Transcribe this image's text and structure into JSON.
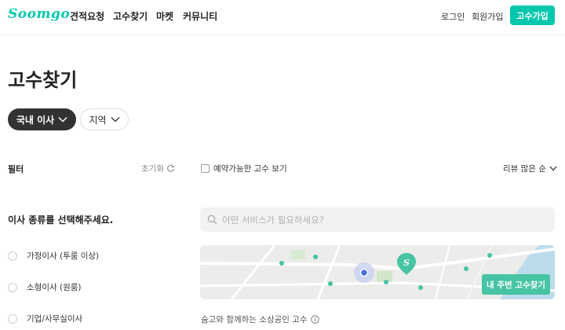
{
  "header": {
    "logo": "Soomgo",
    "nav": [
      "견적요청",
      "고수찾기",
      "마켓",
      "커뮤니티"
    ],
    "login": "로그인",
    "join": "회원가입",
    "signup_button": "고수가입"
  },
  "page_title": "고수찾기",
  "chips": {
    "active": "국내 이사",
    "region": "지역"
  },
  "filter": {
    "label": "필터",
    "reset": "초기화",
    "question": "이사 종류를 선택해주세요.",
    "options": [
      "가정이사 (투룸 이상)",
      "소형이사 (원룸)",
      "기업/사무실이사"
    ]
  },
  "results": {
    "reservable_checkbox_label": "예약가능한 고수 보기",
    "sort_label": "리뷰 많은 순",
    "search_placeholder": "어떤 서비스가 필요하세요?",
    "nearby_button": "내 주변 고수찾기",
    "caption": "숨고와 함께하는 소상공인 고수"
  },
  "colors": {
    "brand": "#00c7ae",
    "map_pin": "#46c4a3",
    "active_chip": "#323232"
  },
  "icons": [
    "chevron-down-icon",
    "refresh-icon",
    "search-icon",
    "info-icon",
    "map-pin-icon",
    "current-location-icon"
  ]
}
